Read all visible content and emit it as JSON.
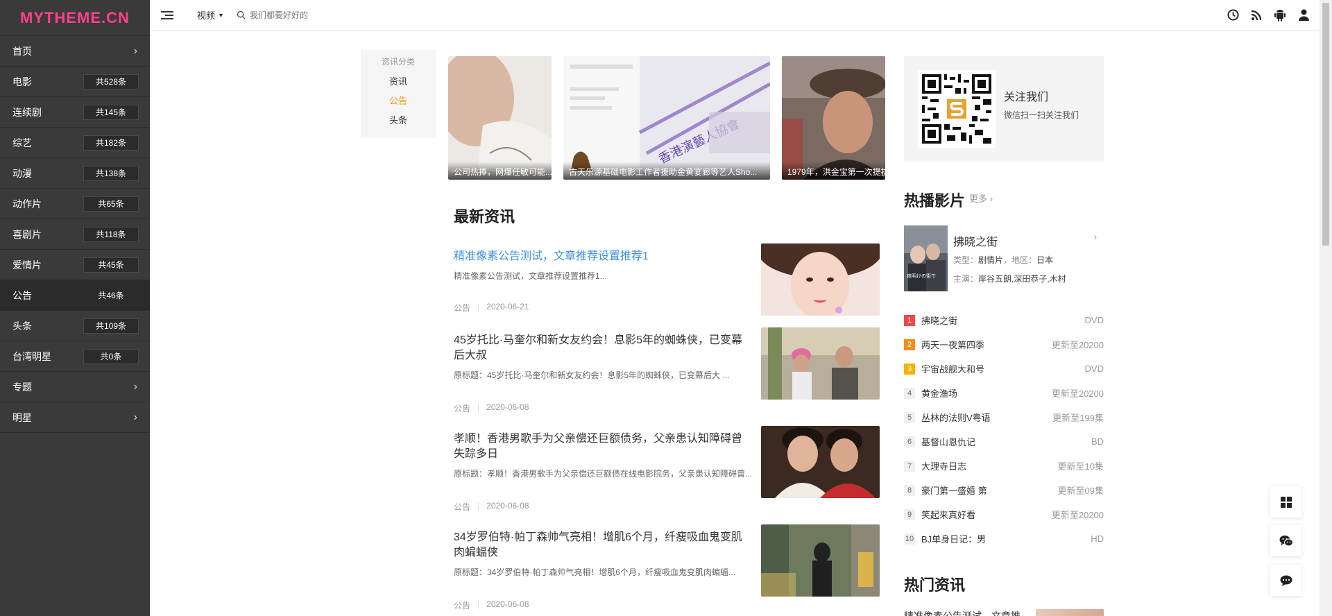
{
  "logo": "MYTHEME.CN",
  "sidebar": {
    "items": [
      {
        "label": "首页",
        "count": null,
        "chevron": true
      },
      {
        "label": "电影",
        "count": "共528条"
      },
      {
        "label": "连续剧",
        "count": "共145条"
      },
      {
        "label": "综艺",
        "count": "共182条"
      },
      {
        "label": "动漫",
        "count": "共138条"
      },
      {
        "label": "动作片",
        "count": "共65条"
      },
      {
        "label": "喜剧片",
        "count": "共118条"
      },
      {
        "label": "爱情片",
        "count": "共45条"
      },
      {
        "label": "公告",
        "count": "共46条",
        "active": true
      },
      {
        "label": "头条",
        "count": "共109条"
      },
      {
        "label": "台湾明星",
        "count": "共0条"
      },
      {
        "label": "专题",
        "count": null,
        "chevron": true
      },
      {
        "label": "明星",
        "count": null,
        "chevron": true
      }
    ]
  },
  "header": {
    "category": "视频",
    "search_placeholder": "我们都要好好的",
    "icons": [
      "history-icon",
      "rss-icon",
      "android-icon",
      "user-icon"
    ]
  },
  "categories": {
    "title": "资讯分类",
    "links": [
      {
        "label": "资讯"
      },
      {
        "label": "公告",
        "active": true
      },
      {
        "label": "头条"
      }
    ]
  },
  "slider": {
    "slides": [
      {
        "caption": "公司热捧，网爆任敏可能..."
      },
      {
        "caption": "古天乐源基础电影工作者援助金黄宴廊等艺人Sho..."
      },
      {
        "caption": "1979年，洪金宝第一次提拔..."
      }
    ]
  },
  "latest": {
    "title": "最新资讯",
    "items": [
      {
        "title": "精准像素公告测试，文章推荐设置推荐1",
        "excerpt": "精准像素公告测试，文章推荐设置推荐1...",
        "category": "公告",
        "date": "2020-06-21",
        "highlight": true
      },
      {
        "title": "45岁托比·马奎尔和新女友约会！息影5年的蜘蛛侠，已变幕后大叔",
        "excerpt": "原标题：45岁托比·马奎尔和新女友约会！息影5年的蜘蛛侠，已变幕后大 ...",
        "category": "公告",
        "date": "2020-06-08"
      },
      {
        "title": "孝顺！香港男歌手为父亲偿还巨额债务，父亲患认知障碍曾失踪多日",
        "excerpt": "原标题：孝顺！香港男歌手为父亲偿还巨额债在线电影院务，父亲患认知障碍曾...",
        "category": "公告",
        "date": "2020-06-08"
      },
      {
        "title": "34岁罗伯特·帕丁森帅气亮相！增肌6个月，纤瘦吸血鬼变肌肉蝙蝠侠",
        "excerpt": "原标题：34岁罗伯特·帕丁森帅气亮相！增肌6个月，纤瘦吸血鬼变肌肉蝙蝠...",
        "category": "公告",
        "date": "2020-06-08"
      }
    ]
  },
  "follow": {
    "title": "关注我们",
    "subtitle": "微信扫一扫关注我们"
  },
  "hot_movies": {
    "title": "热播影片",
    "more": "更多",
    "feature": {
      "name": "拂晓之街",
      "type_label": "类型：",
      "type": "剧情片",
      "region_label": "，地区：",
      "region": "日本",
      "cast_label": "主演：",
      "cast": "岸谷五朗,深田恭子,木村"
    },
    "list": [
      {
        "rank": "1",
        "name": "拂晓之街",
        "status": "DVD"
      },
      {
        "rank": "2",
        "name": "两天一夜第四季",
        "status": "更新至20200"
      },
      {
        "rank": "3",
        "name": "宇宙战舰大和号",
        "status": "DVD"
      },
      {
        "rank": "4",
        "name": "黄金渔场",
        "status": "更新至20200"
      },
      {
        "rank": "5",
        "name": "丛林的法则V粤语",
        "status": "更新至199集"
      },
      {
        "rank": "6",
        "name": "基督山恩仇记",
        "status": "BD"
      },
      {
        "rank": "7",
        "name": "大理寺日志",
        "status": "更新至10集"
      },
      {
        "rank": "8",
        "name": "豪门第一盛婚 第",
        "status": "更新至09集"
      },
      {
        "rank": "9",
        "name": "笑起来真好看",
        "status": "更新至20200"
      },
      {
        "rank": "10",
        "name": "BJ单身日记：男",
        "status": "HD"
      }
    ]
  },
  "hot_news": {
    "title": "热门资讯",
    "peek": "精准像素公告测试，文章推"
  },
  "float_buttons": [
    "windows-icon",
    "wechat-icon",
    "message-icon"
  ]
}
